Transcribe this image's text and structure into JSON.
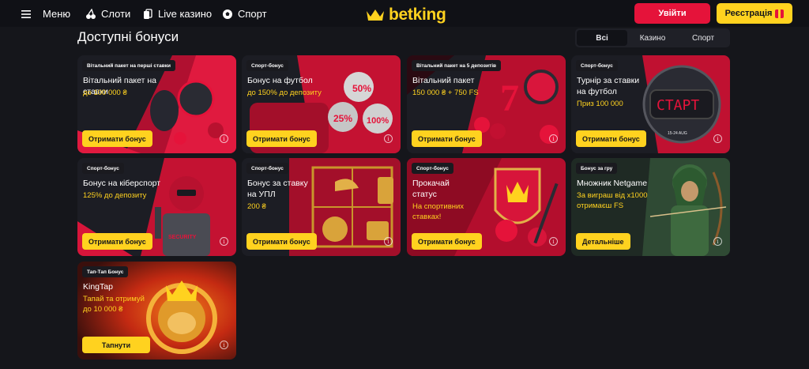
{
  "header": {
    "menu_label": "Меню",
    "slots_label": "Слоти",
    "live_label": "Live казино",
    "sport_label": "Спорт",
    "logo_text": "betking",
    "login_label": "Увійти",
    "register_label": "Реєстрація"
  },
  "page": {
    "title": "Доступні бонуси",
    "filters": [
      "Всі",
      "Казино",
      "Спорт"
    ]
  },
  "cards": [
    {
      "tag": "Вітальний пакет на перші ставки",
      "title": "Вітальний пакет на ставки",
      "subtitle": "до 100 000 ₴",
      "button": "Отримати бонус"
    },
    {
      "tag": "Спорт-бонус",
      "title": "Бонус на футбол",
      "subtitle": "до 150% до депозиту",
      "button": "Отримати бонус",
      "art": [
        "50%",
        "25%",
        "100%"
      ]
    },
    {
      "tag": "Вітальний пакет на 5 депозитів",
      "title": "Вітальний пакет",
      "subtitle": "150 000 ₴ + 750 FS",
      "button": "Отримати бонус"
    },
    {
      "tag": "Спорт-бонус",
      "title": "Турнір за ставки на футбол",
      "subtitle": "Приз 100 000",
      "button": "Отримати бонус",
      "art": [
        "СТАРТ",
        "15-24 AUG"
      ]
    },
    {
      "tag": "Спорт-бонус",
      "title": "Бонус на кіберспорт",
      "subtitle": "125% до депозиту",
      "button": "Отримати бонус",
      "art": [
        "SECURITY"
      ]
    },
    {
      "tag": "Спорт-бонус",
      "title": "Бонус за ставку на УПЛ",
      "subtitle": "200 ₴",
      "button": "Отримати бонус"
    },
    {
      "tag": "Спорт-бонус",
      "title": "Прокачай статус",
      "subtitle": "На спортивних ставках!",
      "button": "Отримати бонус"
    },
    {
      "tag": "Бонус за гру",
      "title": "Множник Netgame",
      "subtitle": "За виграш від х1000 отримаєш FS",
      "button": "Детальніше"
    },
    {
      "tag": "Тап-Тап Бонус",
      "title": "KingTap",
      "subtitle": "Тапай та отримуй до 10 000 ₴",
      "button": "Тапнути"
    }
  ],
  "colors": {
    "accent_yellow": "#ffd21f",
    "login_red": "#e5133a",
    "background": "#15161b"
  },
  "icons": {
    "menu": "hamburger-icon",
    "slots": "cherries-icon",
    "live": "cards-icon",
    "sport": "football-icon",
    "logo": "crown-icon",
    "register": "gift-icon",
    "info": "info-icon"
  }
}
